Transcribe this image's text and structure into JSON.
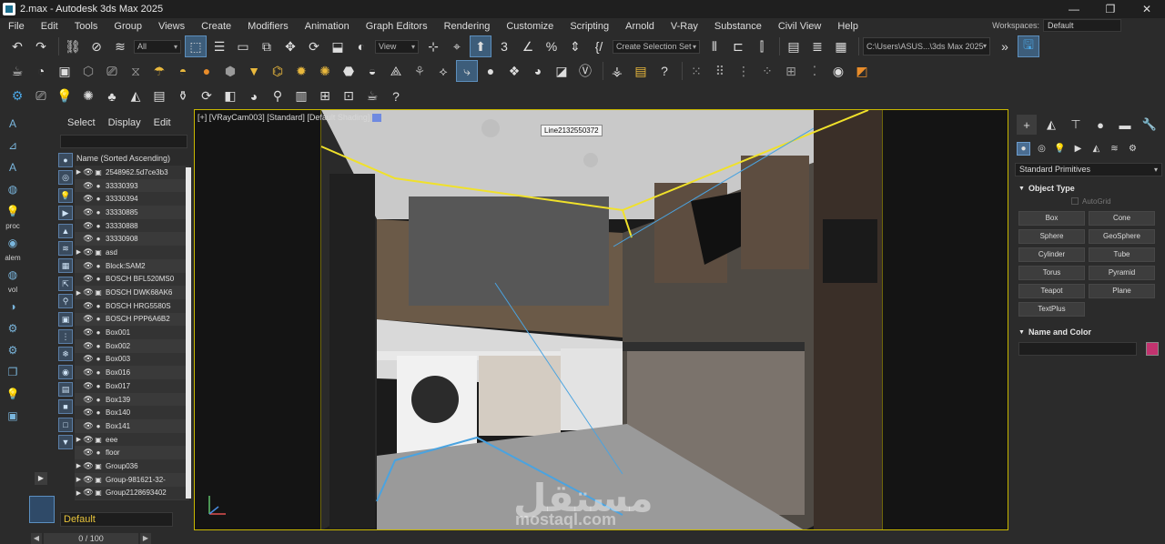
{
  "window": {
    "title": "2.max - Autodesk 3ds Max 2025",
    "controls": [
      "—",
      "❐",
      "✕"
    ]
  },
  "menu": [
    "File",
    "Edit",
    "Tools",
    "Group",
    "Views",
    "Create",
    "Modifiers",
    "Animation",
    "Graph Editors",
    "Rendering",
    "Customize",
    "Scripting",
    "Arnold",
    "V-Ray",
    "Substance",
    "Civil View",
    "Help"
  ],
  "workspace": {
    "label": "Workspaces:",
    "value": "Default"
  },
  "toolbar": {
    "selection_filter": "All",
    "ref_coord": "View",
    "named_selection": "Create Selection Set",
    "project_path": "C:\\Users\\ASUS...\\3ds Max 2025"
  },
  "left_strip": {
    "labels": [
      "proc",
      "alem",
      "vol"
    ]
  },
  "explorer": {
    "tabs": [
      "Select",
      "Display",
      "Edit"
    ],
    "header": "Name (Sorted Ascending)",
    "rows": [
      {
        "expand": "▶",
        "name": "2548962.5d7ce3b3",
        "type": "grp"
      },
      {
        "expand": "",
        "name": "33330393",
        "type": "dot"
      },
      {
        "expand": "",
        "name": "33330394",
        "type": "dot"
      },
      {
        "expand": "",
        "name": "33330885",
        "type": "dot"
      },
      {
        "expand": "",
        "name": "33330888",
        "type": "dot"
      },
      {
        "expand": "",
        "name": "33330908",
        "type": "dot"
      },
      {
        "expand": "▶",
        "name": "asd",
        "type": "grp"
      },
      {
        "expand": "",
        "name": "Block:SAM2",
        "type": "dot"
      },
      {
        "expand": "",
        "name": "BOSCH BFL520MS0",
        "type": "dot"
      },
      {
        "expand": "▶",
        "name": "BOSCH DWK68AK6",
        "type": "grp"
      },
      {
        "expand": "",
        "name": "BOSCH HRG5580S",
        "type": "dot"
      },
      {
        "expand": "",
        "name": "BOSCH PPP6A6B2",
        "type": "dot"
      },
      {
        "expand": "",
        "name": "Box001",
        "type": "dot"
      },
      {
        "expand": "",
        "name": "Box002",
        "type": "dot"
      },
      {
        "expand": "",
        "name": "Box003",
        "type": "dot"
      },
      {
        "expand": "",
        "name": "Box016",
        "type": "dot"
      },
      {
        "expand": "",
        "name": "Box017",
        "type": "dot"
      },
      {
        "expand": "",
        "name": "Box139",
        "type": "dot"
      },
      {
        "expand": "",
        "name": "Box140",
        "type": "dot"
      },
      {
        "expand": "",
        "name": "Box141",
        "type": "dot"
      },
      {
        "expand": "▶",
        "name": "eee",
        "type": "grp"
      },
      {
        "expand": "",
        "name": "floor",
        "type": "dot"
      },
      {
        "expand": "▶",
        "name": "Group036",
        "type": "grp"
      },
      {
        "expand": "▶",
        "name": "Group-981621-32-",
        "type": "grp"
      },
      {
        "expand": "▶",
        "name": "Group2128693402",
        "type": "grp"
      }
    ],
    "layer": "Default"
  },
  "timeline": {
    "value": "0 / 100"
  },
  "viewport": {
    "label": "[+] [VRayCam003] [Standard] [Default Shading]",
    "tooltip": "Line2132550372",
    "watermark_ar": "مستقل",
    "watermark_en": "mostaql.com"
  },
  "command_panel": {
    "dropdown": "Standard Primitives",
    "object_type_title": "Object Type",
    "autogrid_label": "AutoGrid",
    "primitives": [
      "Box",
      "Cone",
      "Sphere",
      "GeoSphere",
      "Cylinder",
      "Tube",
      "Torus",
      "Pyramid",
      "Teapot",
      "Plane",
      "TextPlus"
    ],
    "name_color_title": "Name and Color",
    "object_color": "#c2336f"
  },
  "colors": {
    "viewport_border": "#c9b800",
    "selection_highlight": "#3d5d7a",
    "layer_text": "#e6c23a"
  }
}
